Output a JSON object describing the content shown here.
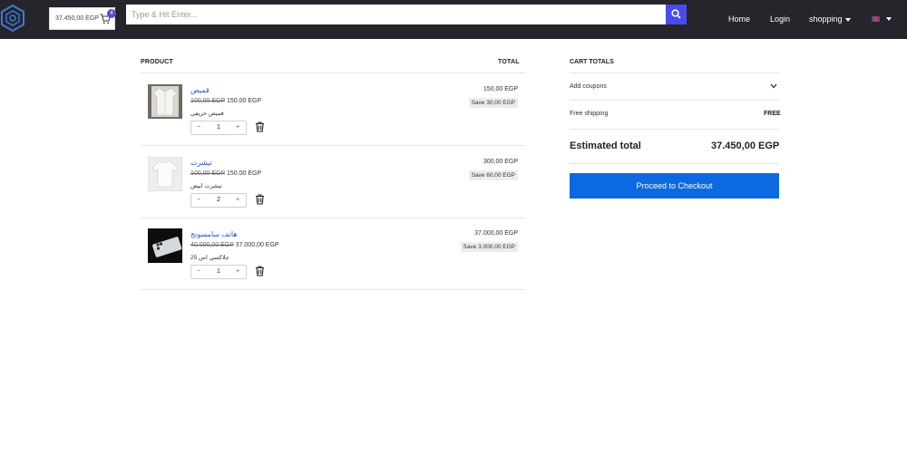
{
  "header": {
    "cart_amount": "37.450,00 EGP",
    "cart_count": "4",
    "search_placeholder": "Type & Hit Enter...",
    "nav": {
      "home": "Home",
      "login": "Login",
      "shopping": "shopping"
    }
  },
  "cart": {
    "product_header": "PRODUCT",
    "total_header": "TOTAL",
    "items": [
      {
        "name": "قميص",
        "old_price": "100,00 EGP",
        "price": "150.00 EGP",
        "description": "قميص خريفي",
        "quantity": "1",
        "line_total": "150,00 EGP",
        "save": "Save 30,00 EGP",
        "minus": "−",
        "plus": "+"
      },
      {
        "name": "تيشرت",
        "old_price": "100,00 EGP",
        "price": "150.00 EGP",
        "description": "تيشرت ابيض",
        "quantity": "2",
        "line_total": "300,00 EGP",
        "save": "Save 60,00 EGP",
        "minus": "−",
        "plus": "+"
      },
      {
        "name": "هاتف سامسونج",
        "old_price": "40.000,00 EGP",
        "price": "37.000,00 EGP",
        "description": "جلاكسي اس 25",
        "quantity": "1",
        "line_total": "37.000,00 EGP",
        "save": "Save 3.000,00 EGP",
        "minus": "−",
        "plus": "+"
      }
    ]
  },
  "totals": {
    "title": "CART TOTALS",
    "coupons": "Add coupons",
    "shipping_label": "Free shipping",
    "shipping_value": "FREE",
    "estimated_label": "Estimated total",
    "estimated_value": "37.450,00 EGP",
    "checkout": "Proceed to Checkout"
  },
  "colors": {
    "header_bg": "#25252b",
    "search_button": "#4a4aef",
    "link": "#2a56c6",
    "checkout_bg": "#0b6adf",
    "badge": "#5b4bdb"
  }
}
